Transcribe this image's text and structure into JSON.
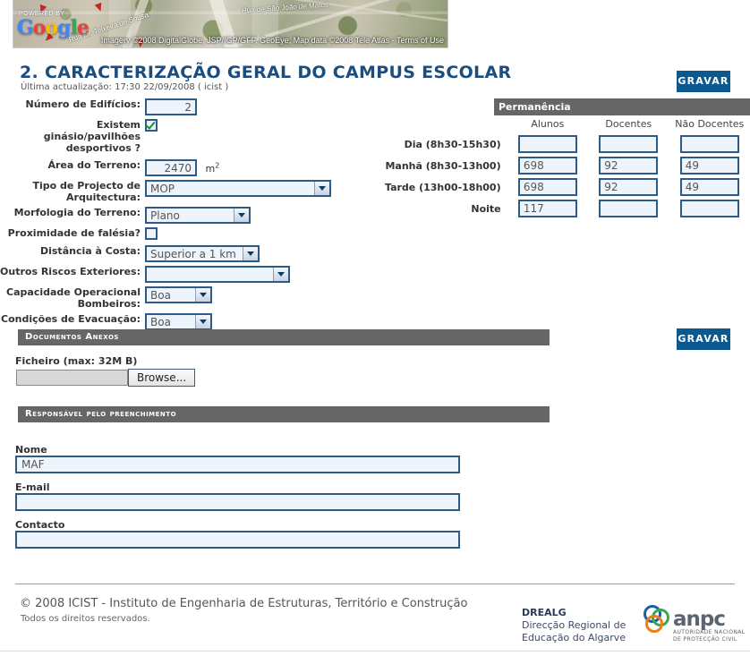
{
  "map": {
    "powered_by": "POWERED BY",
    "google_letters": [
      "G",
      "o",
      "o",
      "g",
      "l",
      "e"
    ],
    "attribution": "Imagery ©2008 DigitalGlobe, JSP/IGP/GFF, GeoEye, Map data ©2008 Tele Atlas - Terms of Use",
    "street_labels": [
      "Rua Dr. Teixeira de Sousa",
      "Rua de São João de Matos"
    ]
  },
  "header": {
    "title": "2. CARACTERIZAÇÃO GERAL DO CAMPUS ESCOLAR",
    "subtitle": "Última actualização: 17:30 22/09/2008 ( icist )",
    "save_label": "GRAVAR"
  },
  "form": {
    "num_edificios": {
      "label": "Número de Edifícios:",
      "value": "2"
    },
    "ginasio": {
      "label": "Existem ginásio/pavilhões desportivos ?",
      "checked": true
    },
    "area_terreno": {
      "label": "Área do Terreno:",
      "value": "2470",
      "unit_prefix": "m",
      "unit_sup": "2"
    },
    "tipo_projecto": {
      "label": "Tipo de Projecto de Arquitectura:",
      "value": "MOP"
    },
    "morfologia": {
      "label": "Morfologia do Terreno:",
      "value": "Plano"
    },
    "falesia": {
      "label": "Proximidade de falésia?",
      "checked": false
    },
    "distancia_costa": {
      "label": "Distância à Costa:",
      "value": "Superior a 1 km"
    },
    "outros_riscos": {
      "label": "Outros Riscos Exteriores:",
      "value": ""
    },
    "capacidade_bombeiros": {
      "label": "Capacidade Operacional Bombeiros:",
      "value": "Boa"
    },
    "condicoes_evacuacao": {
      "label": "Condições de Evacuação:",
      "value": "Boa"
    }
  },
  "permanencia": {
    "title": "Permanência",
    "columns": [
      "Alunos",
      "Docentes",
      "Não Docentes"
    ],
    "rows": [
      {
        "label": "Dia (8h30-15h30)",
        "values": [
          "",
          "",
          ""
        ]
      },
      {
        "label": "Manhã (8h30-13h00)",
        "values": [
          "698",
          "92",
          "49"
        ]
      },
      {
        "label": "Tarde (13h00-18h00)",
        "values": [
          "698",
          "92",
          "49"
        ]
      },
      {
        "label": "Noite",
        "values": [
          "117",
          "",
          ""
        ]
      }
    ]
  },
  "documentos": {
    "section_title": "Documentos Anexos",
    "file_label": "Ficheiro (max: 32M B)",
    "file_value": "",
    "browse_label": "Browse...",
    "save_label": "GRAVAR"
  },
  "responsavel": {
    "section_title": "Responsável pelo preenchimento",
    "nome_label": "Nome",
    "nome_value": "MAF",
    "email_label": "E-mail",
    "email_value": "",
    "contacto_label": "Contacto",
    "contacto_value": ""
  },
  "footer": {
    "copyright": "© 2008 ICIST - Instituto de Engenharia de Estruturas, Território e Construção",
    "rights": "Todos os direitos reservados.",
    "drealg_name": "DREALG",
    "drealg_line1": "Direcção Regional de",
    "drealg_line2": "Educação do Algarve",
    "anpc_word": "anpc",
    "anpc_sub1": "AUTORIDADE NACIONAL",
    "anpc_sub2": "DE  PROTECÇÃO  CIVIL"
  },
  "colors": {
    "title_blue": "#1b4d7e",
    "button_blue": "#0b5a8f",
    "section_gray": "#666666",
    "input_fill": "#eef4fc",
    "input_border": "#2e5a86",
    "check_green": "#1a8a2e"
  }
}
